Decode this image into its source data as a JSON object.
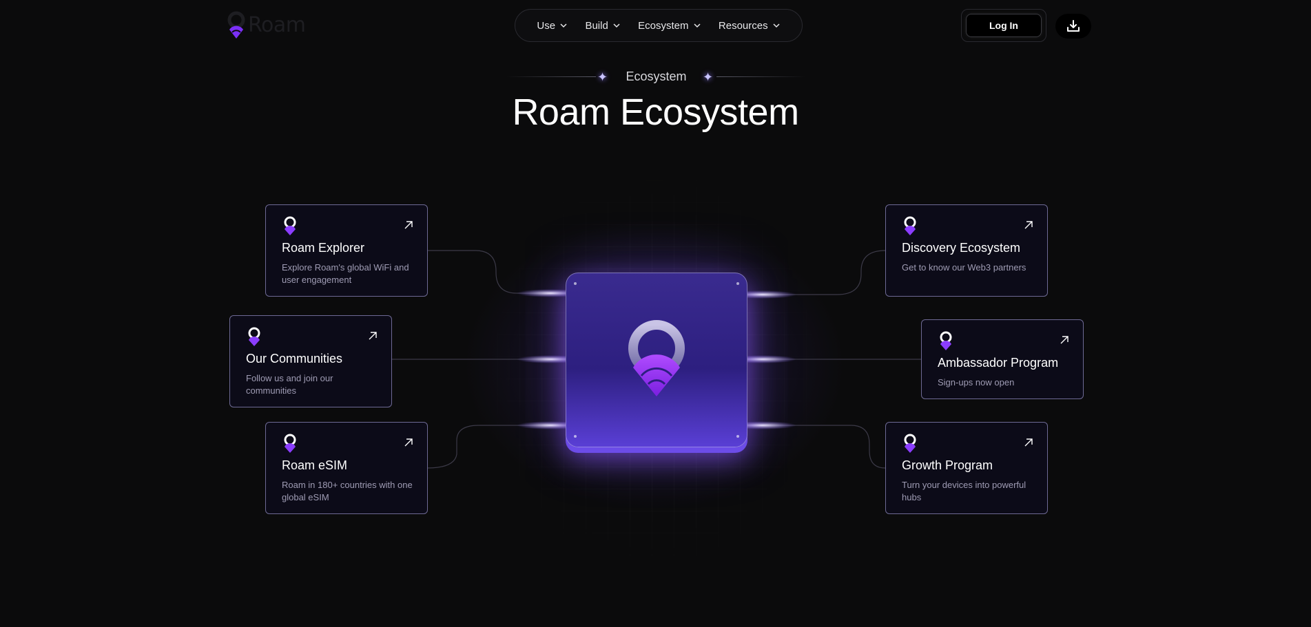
{
  "brand": {
    "name": "Roam",
    "logo_icon": "roam-pin-wifi-icon"
  },
  "nav": {
    "items": [
      {
        "label": "Use"
      },
      {
        "label": "Build"
      },
      {
        "label": "Ecosystem"
      },
      {
        "label": "Resources"
      }
    ]
  },
  "header": {
    "login_label": "Log In",
    "download_icon": "download-icon"
  },
  "section": {
    "eyebrow": "Ecosystem",
    "title": "Roam Ecosystem"
  },
  "cards": [
    {
      "title": "Roam Explorer",
      "desc": "Explore Roam's global WiFi and user engagement"
    },
    {
      "title": "Our Communities",
      "desc": "Follow us and join our communities"
    },
    {
      "title": "Roam eSIM",
      "desc": "Roam in 180+ countries with one global eSIM"
    },
    {
      "title": "Discovery Ecosystem",
      "desc": "Get to know our Web3 partners"
    },
    {
      "title": "Ambassador Program",
      "desc": "Sign-ups now open"
    },
    {
      "title": "Growth Program",
      "desc": "Turn your devices into powerful hubs"
    }
  ],
  "colors": {
    "background": "#0b0b0c",
    "accent": "#8b3dff",
    "card_border": "#6e6a95",
    "chip": "#2d1f80"
  }
}
